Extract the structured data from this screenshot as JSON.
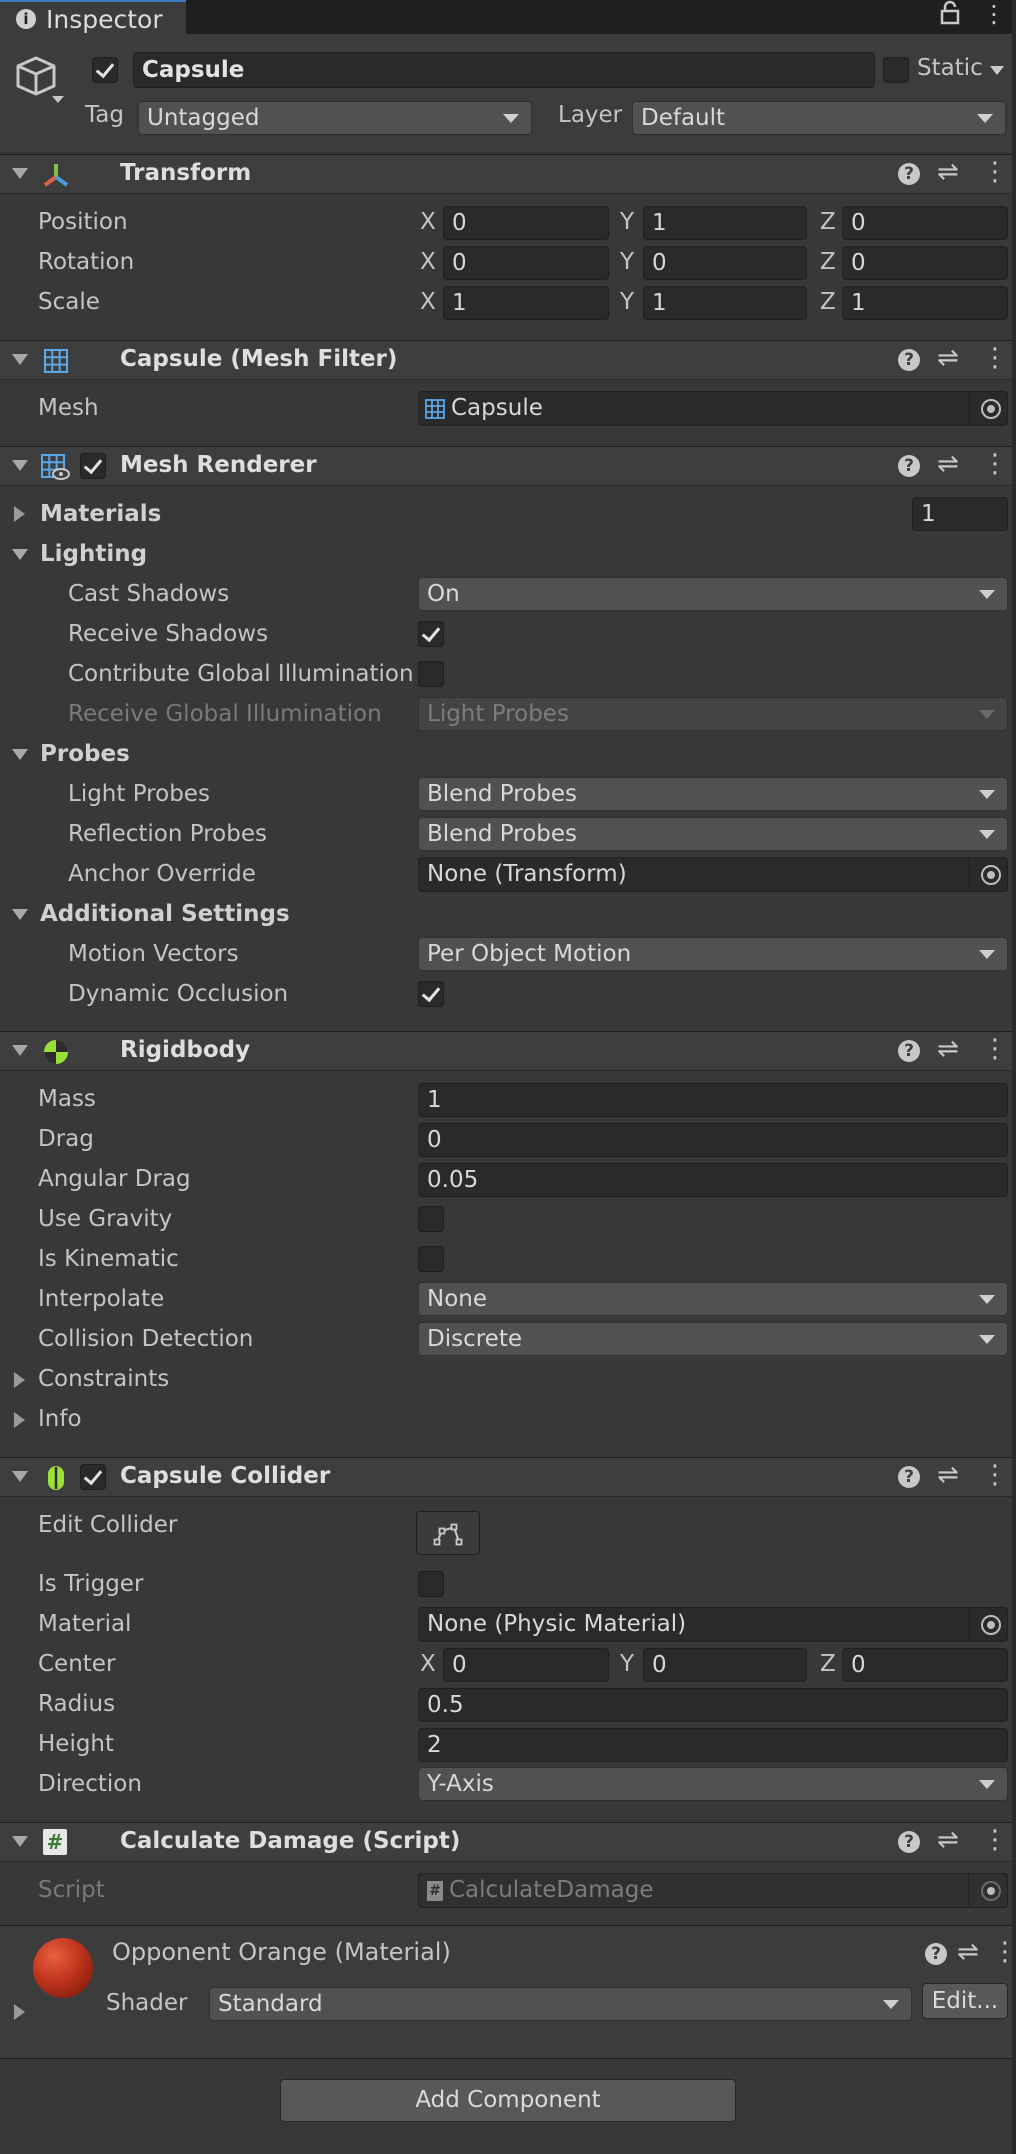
{
  "window": {
    "tab_title": "Inspector"
  },
  "gameobject": {
    "name": "Capsule",
    "active": true,
    "static_label": "Static",
    "static": false,
    "tag_label": "Tag",
    "tag_value": "Untagged",
    "layer_label": "Layer",
    "layer_value": "Default"
  },
  "transform": {
    "title": "Transform",
    "rows": [
      {
        "label": "Position",
        "x": "0",
        "y": "1",
        "z": "0"
      },
      {
        "label": "Rotation",
        "x": "0",
        "y": "0",
        "z": "0"
      },
      {
        "label": "Scale",
        "x": "1",
        "y": "1",
        "z": "1"
      }
    ],
    "axis_x": "X",
    "axis_y": "Y",
    "axis_z": "Z"
  },
  "mesh_filter": {
    "title": "Capsule (Mesh Filter)",
    "mesh_label": "Mesh",
    "mesh_value": "Capsule"
  },
  "mesh_renderer": {
    "title": "Mesh Renderer",
    "enabled": true,
    "materials_label": "Materials",
    "materials_count": "1",
    "lighting_label": "Lighting",
    "cast_shadows_label": "Cast Shadows",
    "cast_shadows_value": "On",
    "receive_shadows_label": "Receive Shadows",
    "receive_shadows": true,
    "contribute_gi_label": "Contribute Global Illumination",
    "contribute_gi": false,
    "receive_gi_label": "Receive Global Illumination",
    "receive_gi_value": "Light Probes",
    "probes_label": "Probes",
    "light_probes_label": "Light Probes",
    "light_probes_value": "Blend Probes",
    "reflection_probes_label": "Reflection Probes",
    "reflection_probes_value": "Blend Probes",
    "anchor_override_label": "Anchor Override",
    "anchor_override_value": "None (Transform)",
    "additional_label": "Additional Settings",
    "motion_vectors_label": "Motion Vectors",
    "motion_vectors_value": "Per Object Motion",
    "dynamic_occlusion_label": "Dynamic Occlusion",
    "dynamic_occlusion": true
  },
  "rigidbody": {
    "title": "Rigidbody",
    "mass_label": "Mass",
    "mass": "1",
    "drag_label": "Drag",
    "drag": "0",
    "angular_drag_label": "Angular Drag",
    "angular_drag": "0.05",
    "use_gravity_label": "Use Gravity",
    "use_gravity": false,
    "is_kinematic_label": "Is Kinematic",
    "is_kinematic": false,
    "interpolate_label": "Interpolate",
    "interpolate": "None",
    "collision_label": "Collision Detection",
    "collision": "Discrete",
    "constraints_label": "Constraints",
    "info_label": "Info"
  },
  "capsule_collider": {
    "title": "Capsule Collider",
    "enabled": true,
    "edit_label": "Edit Collider",
    "is_trigger_label": "Is Trigger",
    "is_trigger": false,
    "material_label": "Material",
    "material": "None (Physic Material)",
    "center_label": "Center",
    "center_x": "0",
    "center_y": "0",
    "center_z": "0",
    "radius_label": "Radius",
    "radius": "0.5",
    "height_label": "Height",
    "height": "2",
    "direction_label": "Direction",
    "direction": "Y-Axis"
  },
  "script_component": {
    "title": "Calculate Damage (Script)",
    "script_label": "Script",
    "script_value": "CalculateDamage"
  },
  "material": {
    "title": "Opponent Orange (Material)",
    "shader_label": "Shader",
    "shader_value": "Standard",
    "edit_label": "Edit..."
  },
  "footer": {
    "add_component": "Add Component"
  },
  "colors": {
    "accent_blue": "#3a79bb",
    "sphere": "#c0341d",
    "rigidbody_icon": "#9be03a"
  }
}
